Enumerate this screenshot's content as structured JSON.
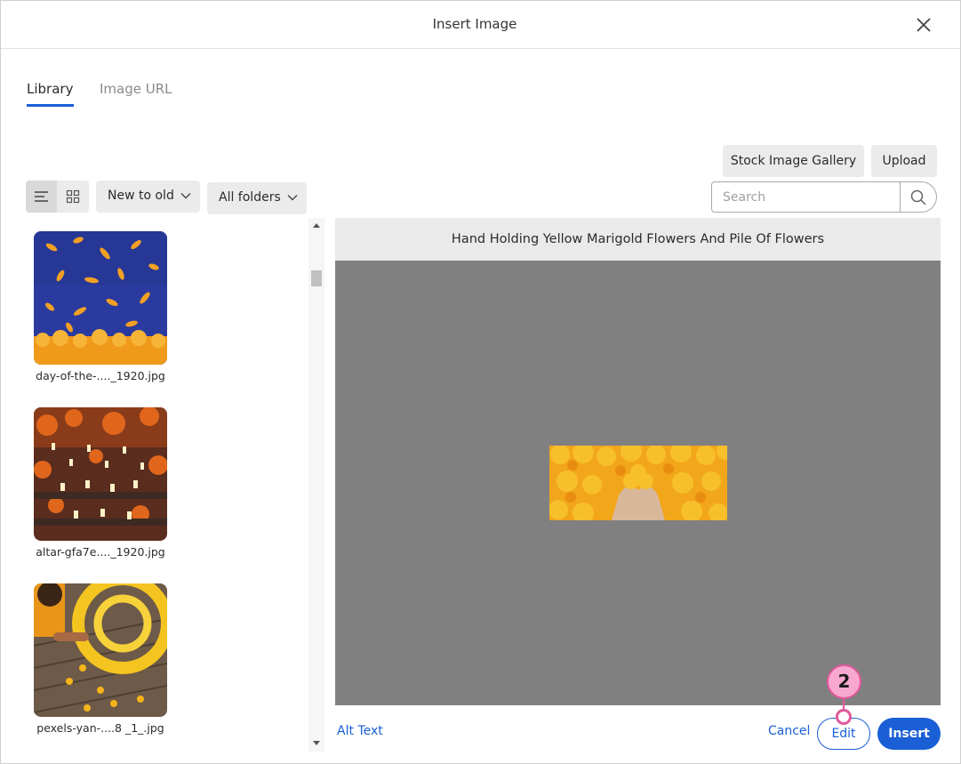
{
  "dialog": {
    "title": "Insert Image",
    "close_icon": "close-icon"
  },
  "tabs": [
    {
      "label": "Library",
      "active": true
    },
    {
      "label": "Image URL",
      "active": false
    }
  ],
  "toolbar": {
    "stock_gallery_label": "Stock Image Gallery",
    "upload_label": "Upload",
    "view_modes": [
      "list-view-icon",
      "grid-view-icon"
    ],
    "active_view": "list",
    "sort_value": "New to old",
    "folder_value": "All folders",
    "search_placeholder": "Search",
    "search_value": ""
  },
  "files": [
    {
      "name": "day-of-the-...._1920.jpg",
      "thumb": "blue background with scattered orange petals"
    },
    {
      "name": "altar-gfa7e...._1920.jpg",
      "thumb": "candles and orange marigolds"
    },
    {
      "name": "pexels-yan-....8 _1_.jpg",
      "thumb": "yellow marigold circle on wooden deck"
    }
  ],
  "preview": {
    "title": "Hand Holding Yellow Marigold Flowers And Pile Of Flowers"
  },
  "footer": {
    "alt_text_label": "Alt Text",
    "cancel_label": "Cancel",
    "edit_label": "Edit",
    "insert_label": "Insert"
  },
  "callout": {
    "number": "2"
  },
  "colors": {
    "accent": "#1a5fd6",
    "callout_fill": "#f7a8cf",
    "callout_border": "#e0589b",
    "preview_bg": "#808080"
  }
}
